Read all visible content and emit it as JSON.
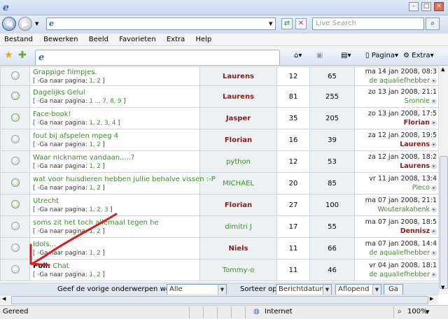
{
  "addressbar": {
    "search_placeholder": "Live Search"
  },
  "menu": [
    "Bestand",
    "Bewerken",
    "Beeld",
    "Favorieten",
    "Extra",
    "Help"
  ],
  "commands": {
    "pagina": "Pagina",
    "extra": "Extra"
  },
  "topics": [
    {
      "title": "Grappige filmpjes.",
      "poll": "",
      "pages_prefix": "[ ",
      "pages_label": "Ga naar pagina: ",
      "pages": "1, 2",
      "pages_suffix": " ]",
      "author": "Laurens",
      "replies": "12",
      "views": "65",
      "last_date": "ma 14 jan 2008, 08:3",
      "last_user": "de aqualiefhebber"
    },
    {
      "title": "Dagelijks Gelul",
      "poll": "",
      "pages_prefix": "[ ",
      "pages_label": "Ga naar pagina: ",
      "pages": "1 ... 7, 8, 9",
      "pages_suffix": " ]",
      "author": "Laurens",
      "replies": "81",
      "views": "255",
      "last_date": "zo 13 jan 2008, 21:1",
      "last_user": "Sronnie"
    },
    {
      "title": "Face-book!",
      "poll": "",
      "pages_prefix": "[ ",
      "pages_label": "Ga naar pagina: ",
      "pages": "1, 2, 3, 4",
      "pages_suffix": " ]",
      "author": "Jasper",
      "replies": "35",
      "views": "205",
      "last_date": "zo 13 jan 2008, 17:5",
      "last_user": "Florian"
    },
    {
      "title": "fout bij afspelen mpeg 4",
      "poll": "",
      "pages_prefix": "[ ",
      "pages_label": "Ga naar pagina: ",
      "pages": "1, 2",
      "pages_suffix": " ]",
      "author": "Florian",
      "replies": "16",
      "views": "39",
      "last_date": "za 12 jan 2008, 19:5",
      "last_user": "Laurens"
    },
    {
      "title": "Waar nickname vandaan.....?",
      "poll": "",
      "pages_prefix": "[ ",
      "pages_label": "Ga naar pagina: ",
      "pages": "1, 2",
      "pages_suffix": " ]",
      "author": "python",
      "replies": "12",
      "views": "53",
      "last_date": "za 12 jan 2008, 18:2",
      "last_user": "Laurens"
    },
    {
      "title": "wat voor huisdieren hebben jullie behalve vissen :-P",
      "poll": "",
      "pages_prefix": "[ ",
      "pages_label": "Ga naar pagina: ",
      "pages": "1, 2",
      "pages_suffix": " ]",
      "author": "MICHAEL",
      "replies": "20",
      "views": "85",
      "last_date": "vr 11 jan 2008, 13:4",
      "last_user": "Pleco"
    },
    {
      "title": "Utrecht",
      "poll": "",
      "pages_prefix": "[ ",
      "pages_label": "Ga naar pagina: ",
      "pages": "1, 2, 3",
      "pages_suffix": " ]",
      "author": "Florian",
      "replies": "27",
      "views": "100",
      "last_date": "ma 07 jan 2008, 21:1",
      "last_user": "Wouterakahenk"
    },
    {
      "title": "soms zit het toch allemaal tegen he",
      "poll": "",
      "pages_prefix": "[ ",
      "pages_label": "Ga naar pagina: ",
      "pages": "1, 2",
      "pages_suffix": " ]",
      "author": "dimitri J",
      "replies": "17",
      "views": "55",
      "last_date": "ma 07 jan 2008, 18:5",
      "last_user": "Dennisz"
    },
    {
      "title": "Idols...",
      "poll": "",
      "pages_prefix": "[ ",
      "pages_label": "Ga naar pagina: ",
      "pages": "1, 2",
      "pages_suffix": " ]",
      "author": "Niels",
      "replies": "11",
      "views": "66",
      "last_date": "ma 07 jan 2008, 14:4",
      "last_user": "de aqualiefhebber"
    },
    {
      "title": "Chat",
      "poll": "Poll:",
      "pages_prefix": "[ ",
      "pages_label": "Ga naar pagina: ",
      "pages": "1, 2",
      "pages_suffix": " ]",
      "author": "Tommy-o",
      "replies": "11",
      "views": "46",
      "last_date": "vr 04 jan 2008, 18:1",
      "last_user": "de aqualiefhebber"
    }
  ],
  "filter": {
    "show_label": "Geef de vorige onderwerpen weer:",
    "show_value": "Alle onderwerpen",
    "sort_label": "Sorteer op",
    "sort_value": "Berichtdatum",
    "order_value": "Aflopend",
    "go_label": "Ga"
  },
  "status": {
    "left": "Gereed",
    "zone": "Internet",
    "zoom": "100%"
  }
}
